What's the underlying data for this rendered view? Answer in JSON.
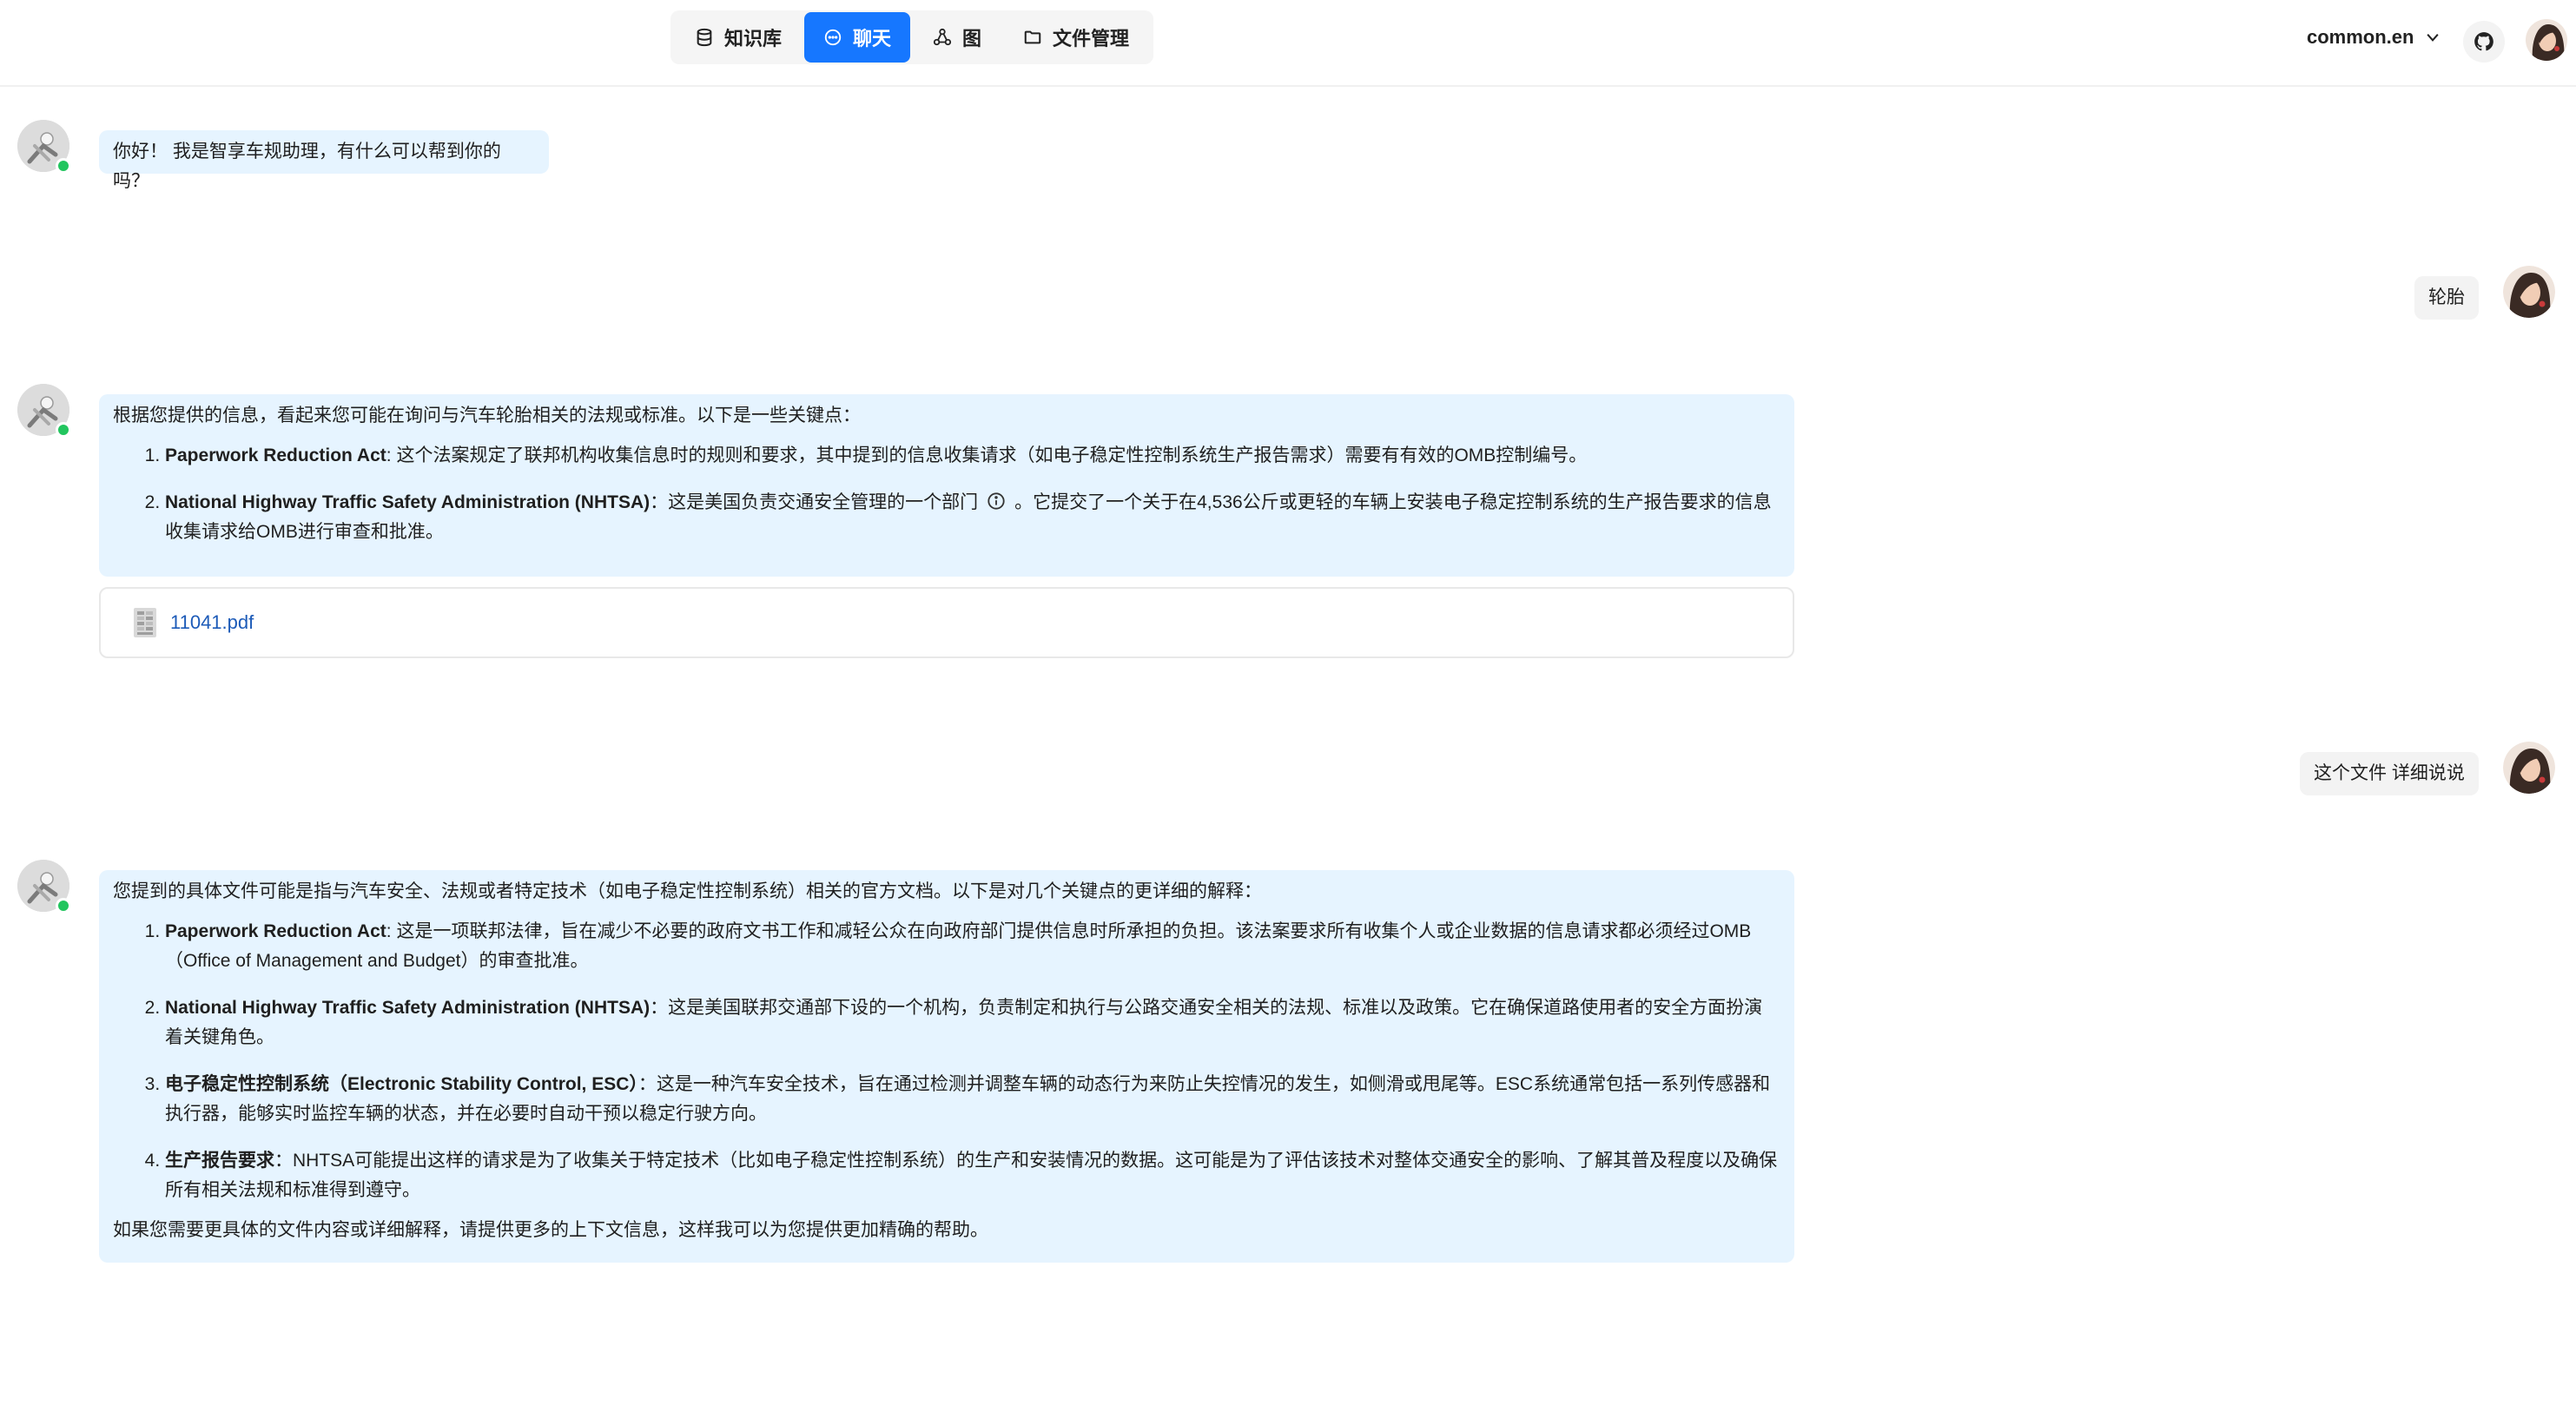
{
  "nav": {
    "tabs": [
      {
        "label": "知识库",
        "icon": "database-icon"
      },
      {
        "label": "聊天",
        "icon": "chat-icon",
        "active": true
      },
      {
        "label": "图",
        "icon": "graph-icon"
      },
      {
        "label": "文件管理",
        "icon": "folder-icon"
      }
    ]
  },
  "header": {
    "language": "common.en",
    "accent_color": "#1677ff"
  },
  "messages": {
    "greeting": "你好！ 我是智享车规助理，有什么可以帮到你的吗？",
    "user1": "轮胎",
    "answer1": {
      "intro": "根据您提供的信息，看起来您可能在询问与汽车轮胎相关的法规或标准。以下是一些关键点：",
      "items": [
        {
          "title": "Paperwork Reduction Act",
          "text": ": 这个法案规定了联邦机构收集信息时的规则和要求，其中提到的信息收集请求（如电子稳定性控制系统生产报告需求）需要有有效的OMB控制编号。"
        },
        {
          "title": "National Highway Traffic Safety Administration (NHTSA)",
          "text": "：这是美国负责交通安全管理的一个部门",
          "text2": "。它提交了一个关于在4,536公斤或更轻的车辆上安装电子稳定控制系统的生产报告要求的信息收集请求给OMB进行审查和批准。"
        }
      ]
    },
    "file": {
      "name": "11041.pdf",
      "icon": "pdf-file-icon"
    },
    "user2": "这个文件 详细说说",
    "answer2": {
      "intro": "您提到的具体文件可能是指与汽车安全、法规或者特定技术（如电子稳定性控制系统）相关的官方文档。以下是对几个关键点的更详细的解释：",
      "items": [
        {
          "title": "Paperwork Reduction Act",
          "text": ": 这是一项联邦法律，旨在减少不必要的政府文书工作和减轻公众在向政府部门提供信息时所承担的负担。该法案要求所有收集个人或企业数据的信息请求都必须经过OMB（Office of Management and Budget）的审查批准。"
        },
        {
          "title": "National Highway Traffic Safety Administration (NHTSA)",
          "text": "：这是美国联邦交通部下设的一个机构，负责制定和执行与公路交通安全相关的法规、标准以及政策。它在确保道路使用者的安全方面扮演着关键角色。"
        },
        {
          "title": "电子稳定性控制系统（Electronic Stability Control, ESC）",
          "text": "：这是一种汽车安全技术，旨在通过检测并调整车辆的动态行为来防止失控情况的发生，如侧滑或甩尾等。ESC系统通常包括一系列传感器和执行器，能够实时监控车辆的状态，并在必要时自动干预以稳定行驶方向。"
        },
        {
          "title": "生产报告要求",
          "text": "：NHTSA可能提出这样的请求是为了收集关于特定技术（比如电子稳定性控制系统）的生产和安装情况的数据。这可能是为了评估该技术对整体交通安全的影响、了解其普及程度以及确保所有相关法规和标准得到遵守。"
        }
      ],
      "outro": "如果您需要更具体的文件内容或详细解释，请提供更多的上下文信息，这样我可以为您提供更加精确的帮助。"
    }
  }
}
